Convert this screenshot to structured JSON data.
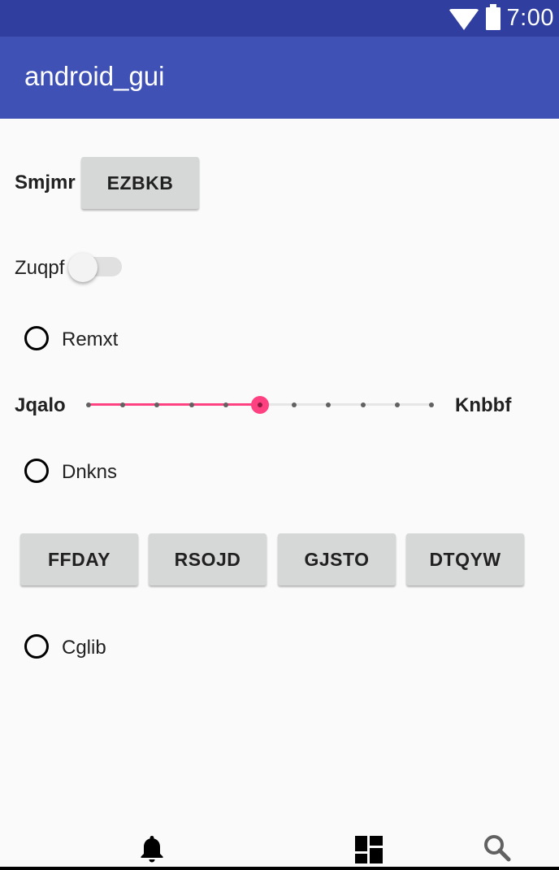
{
  "status_bar": {
    "time": "7:00",
    "icons": [
      "wifi-icon",
      "battery-icon"
    ]
  },
  "app_bar": {
    "title": "android_gui"
  },
  "rows": {
    "smjmr_label": "Smjmr",
    "ezbkb_button": "EZBKB",
    "zuqpf_label": "Zuqpf",
    "zuqpf_switch_on": false,
    "remxt_radio": "Remxt",
    "jqalo_label": "Jqalo",
    "knbbf_label": "Knbbf",
    "seekbar": {
      "max": 10,
      "value": 5
    },
    "dnkns_radio": "Dnkns",
    "buttons": [
      "FFDAY",
      "RSOJD",
      "GJSTO",
      "DTQYW"
    ],
    "cglib_radio": "Cglib"
  },
  "bottom_nav": {
    "items": [
      "bell-icon",
      "dashboard-icon",
      "search-icon"
    ]
  },
  "colors": {
    "status_bar": "#303f9f",
    "app_bar": "#3f51b5",
    "accent": "#ff4081",
    "button": "#d6d7d7",
    "background": "#fafafa"
  }
}
